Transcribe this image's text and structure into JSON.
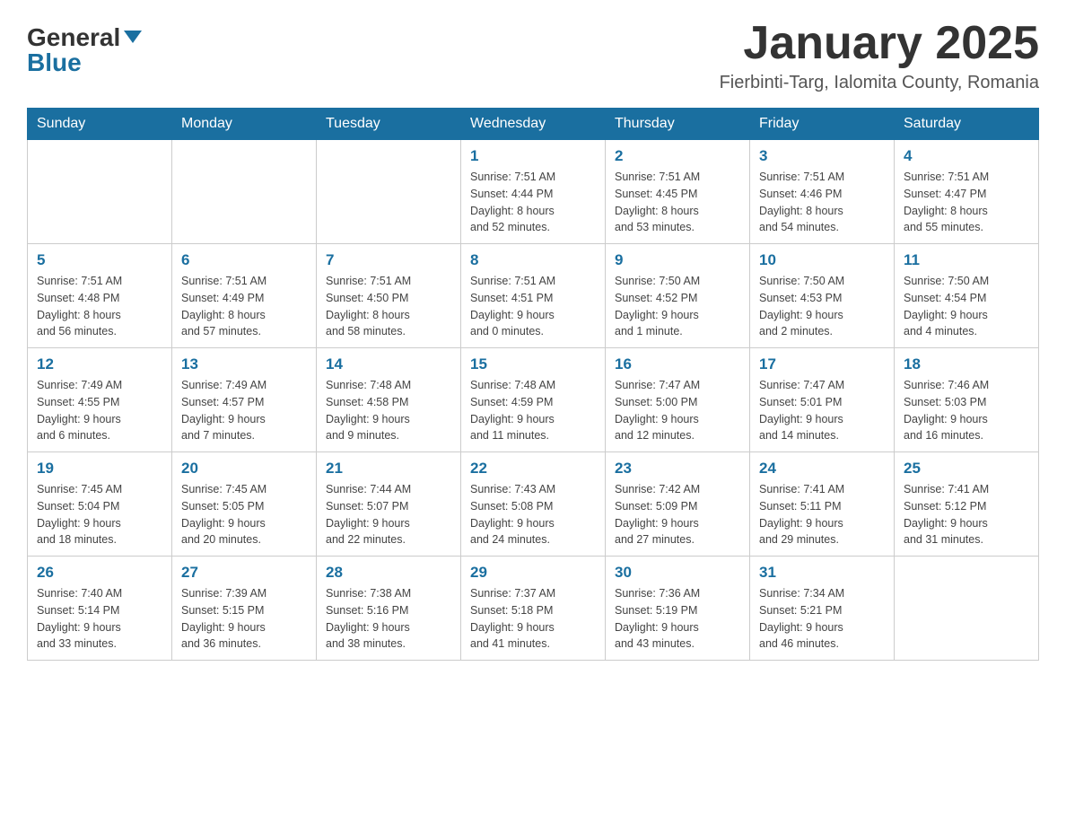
{
  "logo": {
    "general": "General",
    "blue": "Blue"
  },
  "title": "January 2025",
  "subtitle": "Fierbinti-Targ, Ialomita County, Romania",
  "days_of_week": [
    "Sunday",
    "Monday",
    "Tuesday",
    "Wednesday",
    "Thursday",
    "Friday",
    "Saturday"
  ],
  "weeks": [
    [
      {
        "day": "",
        "info": ""
      },
      {
        "day": "",
        "info": ""
      },
      {
        "day": "",
        "info": ""
      },
      {
        "day": "1",
        "info": "Sunrise: 7:51 AM\nSunset: 4:44 PM\nDaylight: 8 hours\nand 52 minutes."
      },
      {
        "day": "2",
        "info": "Sunrise: 7:51 AM\nSunset: 4:45 PM\nDaylight: 8 hours\nand 53 minutes."
      },
      {
        "day": "3",
        "info": "Sunrise: 7:51 AM\nSunset: 4:46 PM\nDaylight: 8 hours\nand 54 minutes."
      },
      {
        "day": "4",
        "info": "Sunrise: 7:51 AM\nSunset: 4:47 PM\nDaylight: 8 hours\nand 55 minutes."
      }
    ],
    [
      {
        "day": "5",
        "info": "Sunrise: 7:51 AM\nSunset: 4:48 PM\nDaylight: 8 hours\nand 56 minutes."
      },
      {
        "day": "6",
        "info": "Sunrise: 7:51 AM\nSunset: 4:49 PM\nDaylight: 8 hours\nand 57 minutes."
      },
      {
        "day": "7",
        "info": "Sunrise: 7:51 AM\nSunset: 4:50 PM\nDaylight: 8 hours\nand 58 minutes."
      },
      {
        "day": "8",
        "info": "Sunrise: 7:51 AM\nSunset: 4:51 PM\nDaylight: 9 hours\nand 0 minutes."
      },
      {
        "day": "9",
        "info": "Sunrise: 7:50 AM\nSunset: 4:52 PM\nDaylight: 9 hours\nand 1 minute."
      },
      {
        "day": "10",
        "info": "Sunrise: 7:50 AM\nSunset: 4:53 PM\nDaylight: 9 hours\nand 2 minutes."
      },
      {
        "day": "11",
        "info": "Sunrise: 7:50 AM\nSunset: 4:54 PM\nDaylight: 9 hours\nand 4 minutes."
      }
    ],
    [
      {
        "day": "12",
        "info": "Sunrise: 7:49 AM\nSunset: 4:55 PM\nDaylight: 9 hours\nand 6 minutes."
      },
      {
        "day": "13",
        "info": "Sunrise: 7:49 AM\nSunset: 4:57 PM\nDaylight: 9 hours\nand 7 minutes."
      },
      {
        "day": "14",
        "info": "Sunrise: 7:48 AM\nSunset: 4:58 PM\nDaylight: 9 hours\nand 9 minutes."
      },
      {
        "day": "15",
        "info": "Sunrise: 7:48 AM\nSunset: 4:59 PM\nDaylight: 9 hours\nand 11 minutes."
      },
      {
        "day": "16",
        "info": "Sunrise: 7:47 AM\nSunset: 5:00 PM\nDaylight: 9 hours\nand 12 minutes."
      },
      {
        "day": "17",
        "info": "Sunrise: 7:47 AM\nSunset: 5:01 PM\nDaylight: 9 hours\nand 14 minutes."
      },
      {
        "day": "18",
        "info": "Sunrise: 7:46 AM\nSunset: 5:03 PM\nDaylight: 9 hours\nand 16 minutes."
      }
    ],
    [
      {
        "day": "19",
        "info": "Sunrise: 7:45 AM\nSunset: 5:04 PM\nDaylight: 9 hours\nand 18 minutes."
      },
      {
        "day": "20",
        "info": "Sunrise: 7:45 AM\nSunset: 5:05 PM\nDaylight: 9 hours\nand 20 minutes."
      },
      {
        "day": "21",
        "info": "Sunrise: 7:44 AM\nSunset: 5:07 PM\nDaylight: 9 hours\nand 22 minutes."
      },
      {
        "day": "22",
        "info": "Sunrise: 7:43 AM\nSunset: 5:08 PM\nDaylight: 9 hours\nand 24 minutes."
      },
      {
        "day": "23",
        "info": "Sunrise: 7:42 AM\nSunset: 5:09 PM\nDaylight: 9 hours\nand 27 minutes."
      },
      {
        "day": "24",
        "info": "Sunrise: 7:41 AM\nSunset: 5:11 PM\nDaylight: 9 hours\nand 29 minutes."
      },
      {
        "day": "25",
        "info": "Sunrise: 7:41 AM\nSunset: 5:12 PM\nDaylight: 9 hours\nand 31 minutes."
      }
    ],
    [
      {
        "day": "26",
        "info": "Sunrise: 7:40 AM\nSunset: 5:14 PM\nDaylight: 9 hours\nand 33 minutes."
      },
      {
        "day": "27",
        "info": "Sunrise: 7:39 AM\nSunset: 5:15 PM\nDaylight: 9 hours\nand 36 minutes."
      },
      {
        "day": "28",
        "info": "Sunrise: 7:38 AM\nSunset: 5:16 PM\nDaylight: 9 hours\nand 38 minutes."
      },
      {
        "day": "29",
        "info": "Sunrise: 7:37 AM\nSunset: 5:18 PM\nDaylight: 9 hours\nand 41 minutes."
      },
      {
        "day": "30",
        "info": "Sunrise: 7:36 AM\nSunset: 5:19 PM\nDaylight: 9 hours\nand 43 minutes."
      },
      {
        "day": "31",
        "info": "Sunrise: 7:34 AM\nSunset: 5:21 PM\nDaylight: 9 hours\nand 46 minutes."
      },
      {
        "day": "",
        "info": ""
      }
    ]
  ]
}
